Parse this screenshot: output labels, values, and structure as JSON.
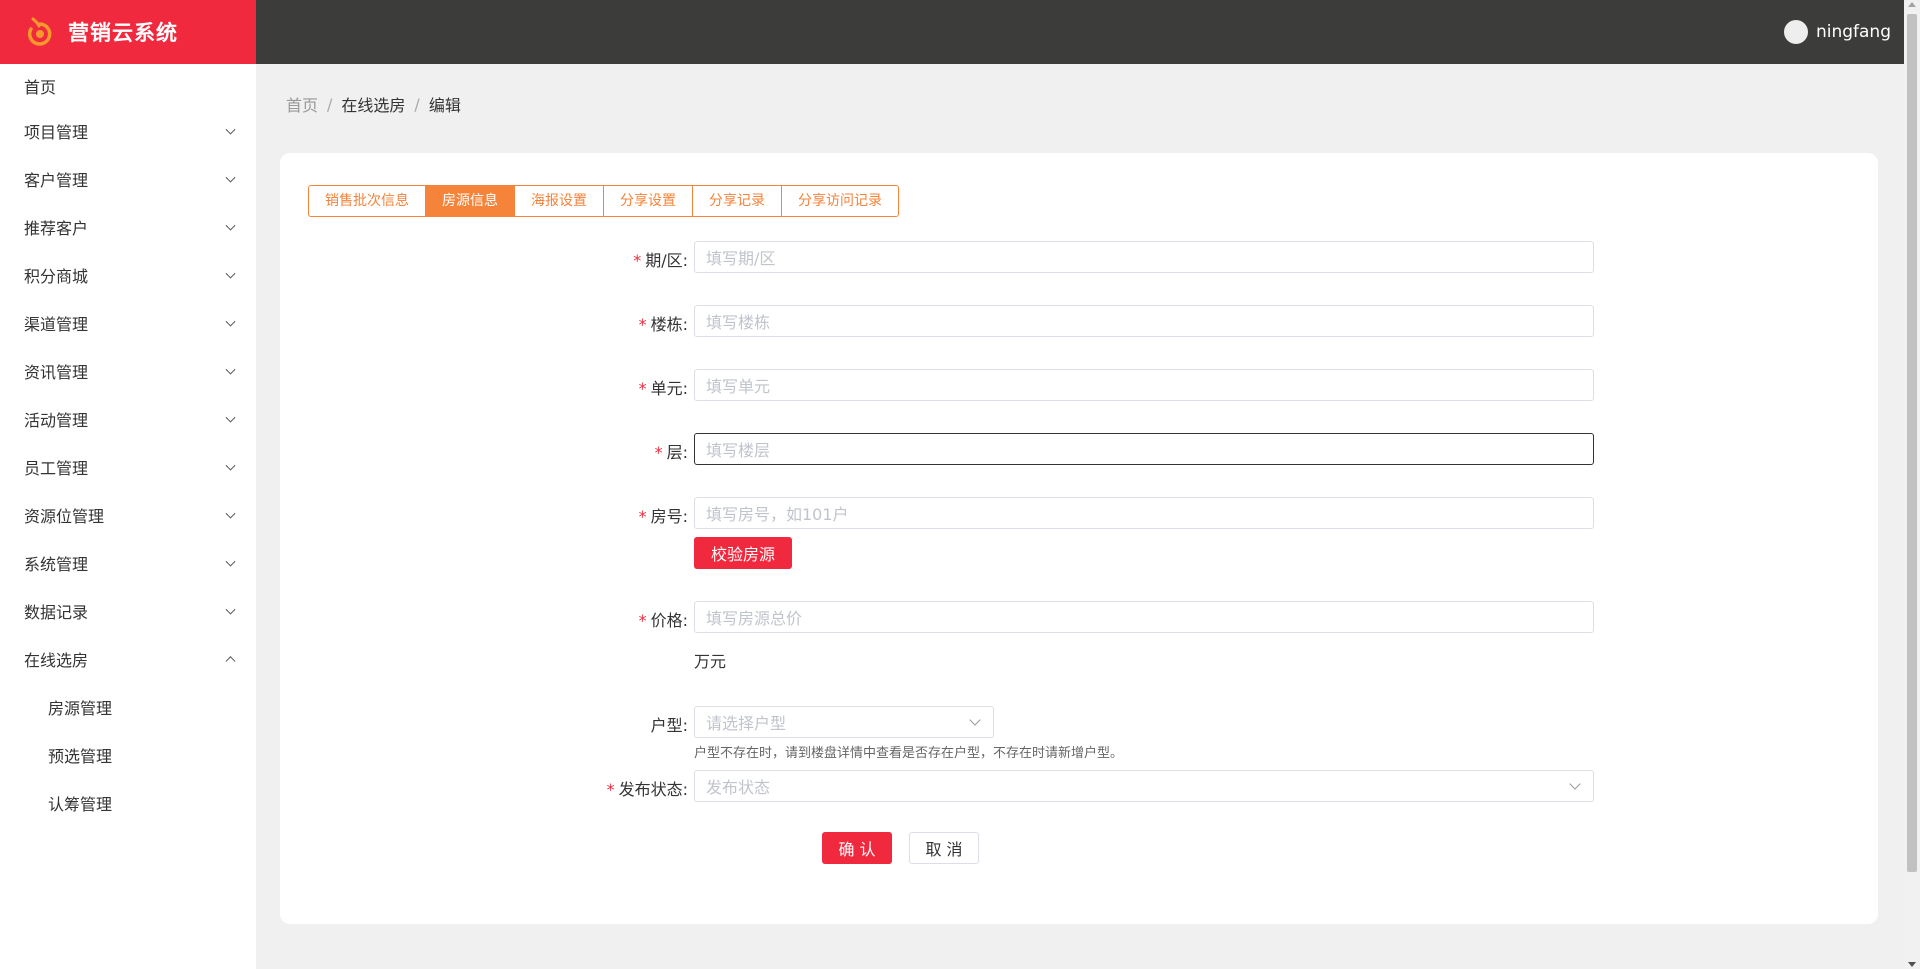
{
  "app": {
    "title": "营销云系统"
  },
  "header": {
    "username": "ningfang"
  },
  "sidebar": {
    "items": [
      {
        "label": "首页"
      },
      {
        "label": "项目管理"
      },
      {
        "label": "客户管理"
      },
      {
        "label": "推荐客户"
      },
      {
        "label": "积分商城"
      },
      {
        "label": "渠道管理"
      },
      {
        "label": "资讯管理"
      },
      {
        "label": "活动管理"
      },
      {
        "label": "员工管理"
      },
      {
        "label": "资源位管理"
      },
      {
        "label": "系统管理"
      },
      {
        "label": "数据记录"
      },
      {
        "label": "在线选房"
      }
    ],
    "sub_items": [
      {
        "label": "房源管理"
      },
      {
        "label": "预选管理"
      },
      {
        "label": "认筹管理"
      }
    ]
  },
  "breadcrumb": {
    "home": "首页",
    "section": "在线选房",
    "current": "编辑",
    "sep": "/"
  },
  "tabs": [
    {
      "label": "销售批次信息"
    },
    {
      "label": "房源信息"
    },
    {
      "label": "海报设置"
    },
    {
      "label": "分享设置"
    },
    {
      "label": "分享记录"
    },
    {
      "label": "分享访问记录"
    }
  ],
  "form": {
    "required_mark": "*",
    "period": {
      "label": "期/区:",
      "placeholder": "填写期/区"
    },
    "building": {
      "label": "楼栋:",
      "placeholder": "填写楼栋"
    },
    "unit": {
      "label": "单元:",
      "placeholder": "填写单元"
    },
    "floor": {
      "label": "层:",
      "placeholder": "填写楼层"
    },
    "room": {
      "label": "房号:",
      "placeholder": "填写房号，如101户"
    },
    "verify_button": "校验房源",
    "price": {
      "label": "价格:",
      "placeholder": "填写房源总价",
      "unit": "万元"
    },
    "layout": {
      "label": "户型:",
      "placeholder": "请选择户型",
      "hint": "户型不存在时，请到楼盘详情中查看是否存在户型，不存在时请新增户型。"
    },
    "status": {
      "label": "发布状态:",
      "placeholder": "发布状态"
    },
    "confirm_button": "确 认",
    "cancel_button": "取 消"
  },
  "colors": {
    "brand": "#f0293e",
    "tab_accent": "#f5833a",
    "header_bg": "#3c3c3a"
  }
}
